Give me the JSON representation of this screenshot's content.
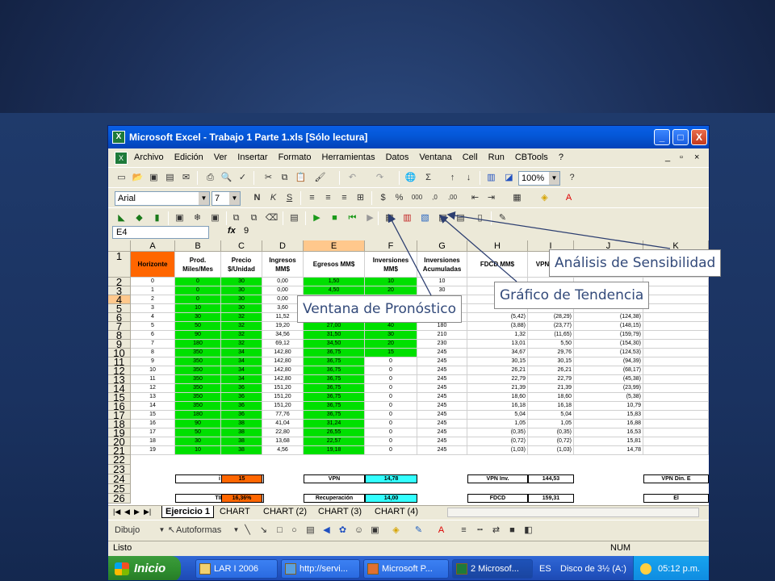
{
  "window": {
    "title": "Microsoft Excel - Trabajo 1 Parte 1.xls  [Sólo lectura]",
    "controls": [
      "_",
      "□",
      "X"
    ]
  },
  "menu": {
    "items": [
      "Archivo",
      "Edición",
      "Ver",
      "Insertar",
      "Formato",
      "Herramientas",
      "Datos",
      "Ventana",
      "Cell",
      "Run",
      "CBTools",
      "?"
    ],
    "doc_controls": [
      "_",
      "▫",
      "×"
    ]
  },
  "toolbar_standard": {
    "zoom": "100%"
  },
  "toolbar_format": {
    "font": "Arial",
    "size": "7"
  },
  "formula_bar": {
    "cell_ref": "E4",
    "fx": "fx",
    "value": "9"
  },
  "columns": [
    "A",
    "B",
    "C",
    "D",
    "E",
    "F",
    "G",
    "H",
    "I",
    "J",
    "K"
  ],
  "header_row": {
    "A": "Horizonte",
    "B": "Prod. Miles/Mes",
    "C": "Precio $/Unidad",
    "D": "Ingresos MM$",
    "E": "Egresos MM$",
    "F": "Inversiones MM$",
    "G": "Inversiones Acumuladas",
    "H": "FDCD MM$",
    "I": "VPN MM$",
    "J": "",
    "K": ""
  },
  "row_numbers": [
    "1",
    "2",
    "3",
    "4",
    "5",
    "6",
    "7",
    "8",
    "9",
    "10",
    "11",
    "12",
    "13",
    "14",
    "15",
    "16",
    "17",
    "18",
    "19",
    "20",
    "21",
    "22",
    "23",
    "24",
    "25",
    "26"
  ],
  "rows": [
    [
      "0",
      "0",
      "30",
      "0,00",
      "1,50",
      "10",
      "10",
      "",
      "",
      ""
    ],
    [
      "1",
      "0",
      "30",
      "0,00",
      "4,50",
      "20",
      "30",
      "",
      "",
      ""
    ],
    [
      "2",
      "0",
      "30",
      "0,00",
      "",
      "",
      "",
      "",
      "",
      ""
    ],
    [
      "3",
      "10",
      "30",
      "3,60",
      "",
      "",
      "",
      "",
      "",
      ""
    ],
    [
      "4",
      "30",
      "32",
      "11,52",
      "",
      "",
      "",
      "(5,42)",
      "(28,29)",
      "(124,38)"
    ],
    [
      "5",
      "50",
      "32",
      "19,20",
      "27,00",
      "40",
      "180",
      "(3,88)",
      "(23,77)",
      "(148,15)"
    ],
    [
      "6",
      "90",
      "32",
      "34,56",
      "31,50",
      "30",
      "210",
      "1,32",
      "(11,65)",
      "(159,79)"
    ],
    [
      "7",
      "180",
      "32",
      "69,12",
      "34,50",
      "20",
      "230",
      "13,01",
      "5,50",
      "(154,30)"
    ],
    [
      "8",
      "350",
      "34",
      "142,80",
      "36,75",
      "15",
      "245",
      "34,67",
      "29,76",
      "(124,53)"
    ],
    [
      "9",
      "350",
      "34",
      "142,80",
      "36,75",
      "0",
      "245",
      "30,15",
      "30,15",
      "(94,39)"
    ],
    [
      "10",
      "350",
      "34",
      "142,80",
      "36,75",
      "0",
      "245",
      "26,21",
      "26,21",
      "(68,17)"
    ],
    [
      "11",
      "350",
      "34",
      "142,80",
      "36,75",
      "0",
      "245",
      "22,79",
      "22,79",
      "(45,38)"
    ],
    [
      "12",
      "350",
      "36",
      "151,20",
      "36,75",
      "0",
      "245",
      "21,39",
      "21,39",
      "(23,99)"
    ],
    [
      "13",
      "350",
      "36",
      "151,20",
      "36,75",
      "0",
      "245",
      "18,60",
      "18,60",
      "(5,38)"
    ],
    [
      "14",
      "350",
      "36",
      "151,20",
      "36,75",
      "0",
      "245",
      "16,18",
      "16,18",
      "10,79"
    ],
    [
      "15",
      "180",
      "36",
      "77,76",
      "36,75",
      "0",
      "245",
      "5,04",
      "5,04",
      "15,83"
    ],
    [
      "16",
      "90",
      "38",
      "41,04",
      "31,24",
      "0",
      "245",
      "1,05",
      "1,05",
      "16,88"
    ],
    [
      "17",
      "50",
      "38",
      "22,80",
      "26,55",
      "0",
      "245",
      "(0,35)",
      "(0,35)",
      "16,53"
    ],
    [
      "18",
      "30",
      "38",
      "13,68",
      "22,57",
      "0",
      "245",
      "(0,72)",
      "(0,72)",
      "15,81"
    ],
    [
      "19",
      "10",
      "38",
      "4,56",
      "19,18",
      "0",
      "245",
      "(1,03)",
      "(1,03)",
      "14,78"
    ]
  ],
  "summary": {
    "i_label": "i",
    "i_value": "15",
    "vpn_label": "VPN",
    "vpn_value": "14,78",
    "vpn_inv_label": "VPN Inv.",
    "vpn_inv_value": "144,53",
    "vpn_din_label": "VPN Din. E",
    "tir_label": "TIR",
    "tir_value": "16,36%",
    "recup_label": "Recuperación",
    "recup_value": "14,00",
    "fdcd_label": "FDCD",
    "fdcd_value": "159,31",
    "el_label": "El"
  },
  "sheet_tabs": [
    "Ejercicio 1",
    "CHART",
    "CHART (2)",
    "CHART (3)",
    "CHART (4)"
  ],
  "drawing_toolbar": {
    "draw": "Dibujo",
    "autoshapes": "Autoformas"
  },
  "status": {
    "left": "Listo",
    "num": "NUM"
  },
  "taskbar": {
    "start": "Inicio",
    "tasks": [
      "LAR I 2006",
      "http://servi...",
      "Microsoft P...",
      "2 Microsof...",
      "Disco de 3½ (A:)"
    ],
    "lang": "ES",
    "clock": "05:12 p.m."
  },
  "callouts": {
    "sensitivity": "Análisis de Sensibilidad",
    "trend": "Gráfico de Tendencia",
    "forecast": "Ventana de Pronóstico"
  },
  "colors": {
    "green_cell": "#00e000",
    "orange_cell": "#ff6600",
    "cyan_cell": "#33ffff",
    "title_blue": "#0458d8"
  }
}
